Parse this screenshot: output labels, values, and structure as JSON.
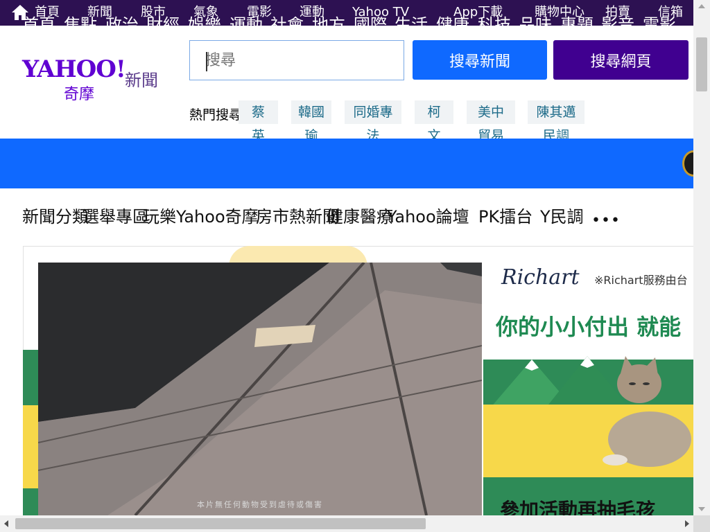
{
  "topnav": {
    "items": [
      "首頁",
      "新聞",
      "股市",
      "氣象",
      "電影",
      "運動",
      "Yahoo TV",
      "App下載",
      "購物中心",
      "拍賣",
      "信箱"
    ]
  },
  "header": {
    "logo_text": "YAHOO!",
    "logo_sub": "奇摩",
    "logo_section": "新聞",
    "search_placeholder": "搜尋",
    "search_news_label": "搜尋新聞",
    "search_web_label": "搜尋網頁",
    "hot_label": "熱門搜尋：",
    "hot_tags": [
      "蔡英文",
      "韓國瑜",
      "同婚專法",
      "柯文哲",
      "美中貿易",
      "陳其邁民調"
    ]
  },
  "categories": {
    "items": [
      "首頁",
      "焦點",
      "政治",
      "財經",
      "娛樂",
      "運動",
      "社會",
      "地方",
      "國際",
      "生活",
      "健康",
      "科技",
      "品味",
      "專題",
      "影音",
      "電影"
    ],
    "active_index": 0
  },
  "subnav": {
    "items": [
      "新聞分類",
      "選舉專區",
      "玩樂Yahoo奇摩",
      "房市熱新聞",
      "健康醫療",
      "Yahoo論壇",
      "PK擂台",
      "Y民調"
    ],
    "more_label": "•••"
  },
  "ad": {
    "video_caption": "本片無任何動物受到虐待或傷害",
    "brand": "Richart",
    "brand_note": "※Richart服務由台",
    "headline": "你的小小付出 就能",
    "cta": "參加活動再抽毛孩"
  },
  "colors": {
    "topbar": "#2d1152",
    "catbar": "#0f69ff",
    "search_news": "#0f69ff",
    "search_web": "#400090",
    "logo": "#6001d2"
  }
}
